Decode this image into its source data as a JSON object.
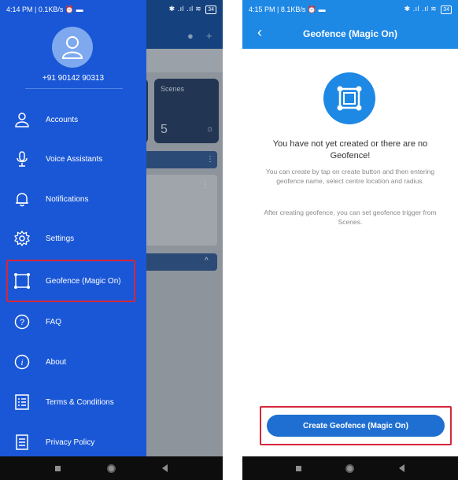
{
  "left_screen": {
    "status_bar": {
      "time_info": "4:14 PM | 0.1KB/s",
      "signal": "✱ .ıl .ıl",
      "battery": "34"
    },
    "drawer": {
      "phone_number": "+91 90142 90313",
      "menu": [
        {
          "label": "Accounts",
          "icon": "user-icon"
        },
        {
          "label": "Voice Assistants",
          "icon": "microphone-icon"
        },
        {
          "label": "Notifications",
          "icon": "bell-icon"
        },
        {
          "label": "Settings",
          "icon": "gear-icon"
        },
        {
          "label": "Geofence (Magic On)",
          "icon": "geofence-icon",
          "highlighted": true
        },
        {
          "label": "FAQ",
          "icon": "question-icon"
        },
        {
          "label": "About",
          "icon": "info-icon"
        },
        {
          "label": "Terms & Conditions",
          "icon": "checklist-icon"
        },
        {
          "label": "Privacy Policy",
          "icon": "document-icon"
        }
      ]
    },
    "background_app": {
      "card_title": "Scenes",
      "card_count": "5"
    }
  },
  "right_screen": {
    "status_bar": {
      "time_info": "4:15 PM | 8.1KB/s",
      "signal": "✱ .ıl .ıl",
      "battery": "34"
    },
    "header": {
      "title": "Geofence (Magic On)"
    },
    "empty_state": {
      "title": "You have not yet created or there are no Geofence!",
      "description": "You can create by tap on create button and then entering geofence name, select centre location and radius.",
      "description2": "After creating geofence, you can set geofence trigger from Scenes."
    },
    "create_button_label": "Create Geofence (Magic On)"
  },
  "colors": {
    "drawer_blue": "#1a57d6",
    "header_blue": "#1e88e5",
    "button_blue": "#1e6fd1",
    "highlight_red": "#d6263a"
  }
}
